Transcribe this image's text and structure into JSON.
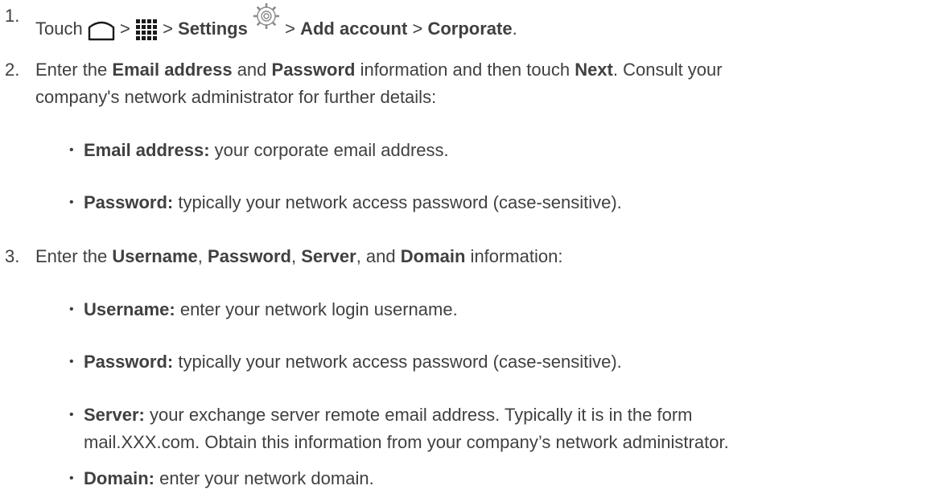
{
  "step1": {
    "num": "1.",
    "touch": "Touch",
    "sep1": ">",
    "sep2": ">",
    "settings": "Settings",
    "sep3": ">",
    "add_account": "Add account",
    "sep4": ">",
    "corporate": "Corporate",
    "end": ".",
    "icons": [
      "home-icon",
      "apps-icon",
      "gear-icon"
    ]
  },
  "step2": {
    "num": "2.",
    "t1": "Enter the ",
    "email_address": "Email address",
    "t2": " and ",
    "password": "Password",
    "t3": " information and then touch ",
    "next": "Next",
    "t4": ". Consult your",
    "line2": "company's network administrator for further details:",
    "bullets": [
      {
        "label": "Email address:",
        "text": " your corporate email address."
      },
      {
        "label": "Password:",
        "text": " typically your network access password (case-sensitive)."
      }
    ]
  },
  "step3": {
    "num": "3.",
    "t1": "Enter the ",
    "username": "Username",
    "c1": ", ",
    "password": "Password",
    "c2": ", ",
    "server": "Server",
    "t2": ", and ",
    "domain": "Domain",
    "t3": " information:",
    "bullets": [
      {
        "label": "Username:",
        "text": " enter your network login username."
      },
      {
        "label": "Password:",
        "text": " typically your network access password (case-sensitive)."
      },
      {
        "label": "Server:",
        "text": " your exchange server remote email address. Typically it is in the form",
        "line2": "mail.XXX.com. Obtain this information from your company’s network administrator."
      },
      {
        "label": "Domain:",
        "text": " enter your network domain."
      }
    ]
  },
  "bullet_char": "•"
}
